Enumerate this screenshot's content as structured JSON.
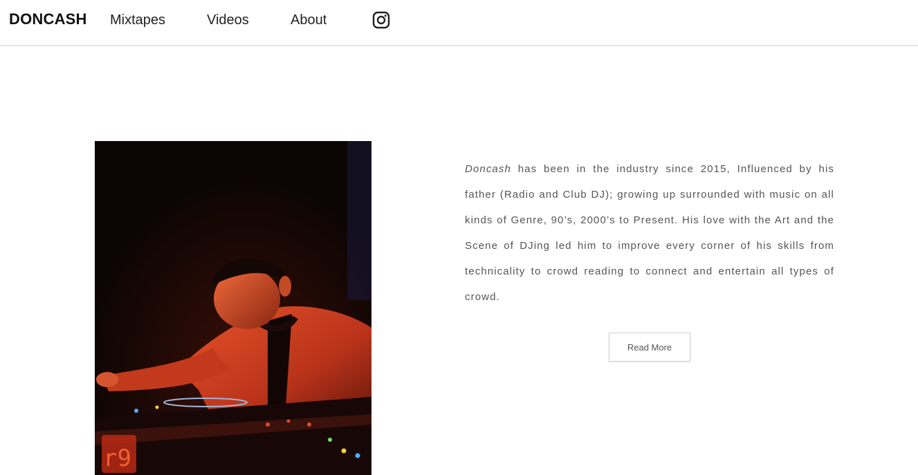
{
  "navbar": {
    "brand": "DONCASH",
    "links": [
      {
        "label": "Mixtapes"
      },
      {
        "label": "Videos"
      },
      {
        "label": "About"
      }
    ],
    "social_icon": "instagram-icon"
  },
  "about": {
    "photo_alt": "DJ performing at turntables under red light",
    "bio_name": "Doncash",
    "bio_text": " has been in the industry since 2015, Influenced by his father (Radio and Club DJ); growing up surrounded with music on all kinds of Genre, 90’s, 2000’s to Present. His love with the Art and the Scene of DJing led him to improve every corner of his skills from technicality to crowd reading to connect and entertain all types of crowd.",
    "read_more_label": "Read More"
  },
  "colors": {
    "text_dark": "#111111",
    "body_text": "#555555",
    "border": "#cfcfcf",
    "photo_light": "#d8441c"
  }
}
